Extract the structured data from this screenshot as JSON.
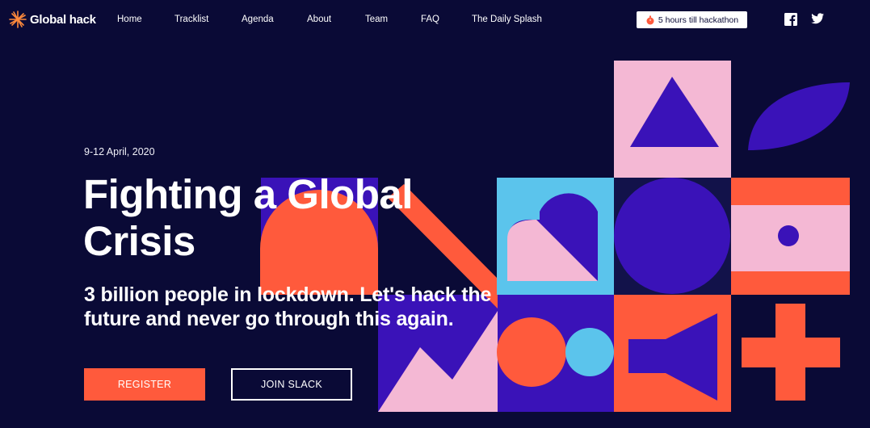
{
  "nav": {
    "logo_text": "Global hack",
    "links": [
      "Home",
      "Tracklist",
      "Agenda",
      "About",
      "Team",
      "FAQ",
      "The Daily Splash"
    ],
    "countdown": "5 hours till hackathon",
    "social": [
      "facebook-icon",
      "twitter-icon"
    ]
  },
  "hero": {
    "date": "9-12 April, 2020",
    "title_line1": "Fighting a Global",
    "title_line2": "Crisis",
    "subtitle_line1": "3 billion people in lockdown. Let's hack the",
    "subtitle_line2": "future and never go through this again.",
    "register_label": "REGISTER",
    "slack_label": "JOIN SLACK"
  },
  "colors": {
    "background": "#0a0a36",
    "accent": "#ff5a3c",
    "indigo": "#3a12b8",
    "pink": "#f4b8d4",
    "sky": "#5bc4ec"
  }
}
